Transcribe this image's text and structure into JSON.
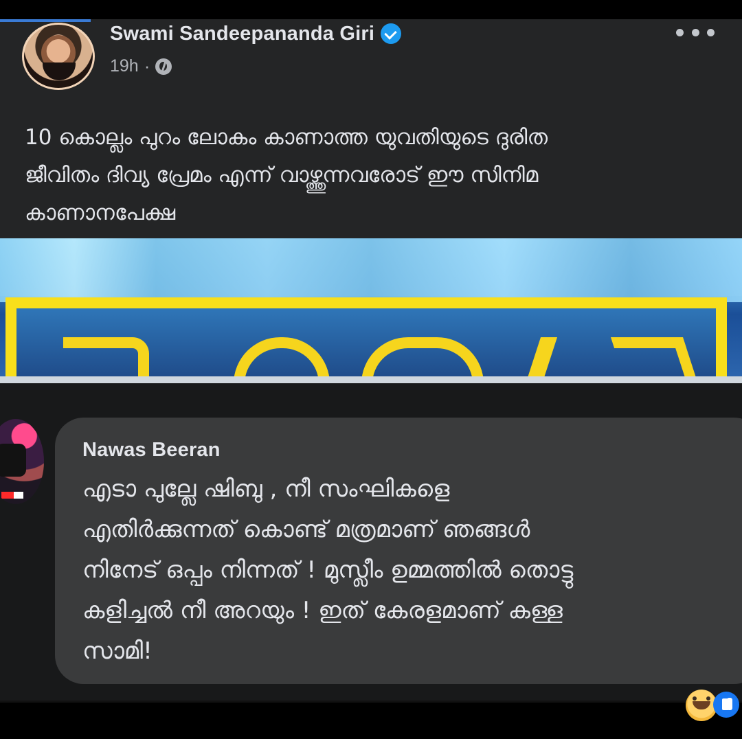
{
  "post": {
    "author": "Swami Sandeepananda Giri",
    "time": "19h",
    "dot": "·",
    "text": "10 കൊല്ലം പുറം ലോകം കാണാത്ത യുവതിയുടെ ദുരിത\nജീവിതം ദിവ്യ പ്രേമം എന്ന് വാഴ്ത്തുന്നവരോട് ഈ സിനിമ\nകാണാനപേക്ഷ"
  },
  "comment": {
    "author": "Nawas Beeran",
    "text": "എടാ പുല്ലേ  ഷിബു , നീ സംഘികളെ\nഎതിർക്കുന്നത് കൊണ്ട് മത്രമാണ് ഞങ്ങൾ\nനിനേട് ഒപ്പം നിന്നത് ! മുസ്ലീം ഉമ്മത്തിൽ തൊട്ടു\nകളിച്ചൽ നീ അറയും ! ഇത് കേരളമാണ് കള്ള\nസാമി!"
  },
  "colors": {
    "facebook_blue": "#1d9bf0",
    "card_background": "#242526",
    "comment_bubble": "#3a3b3c",
    "text_primary": "#e4e6eb",
    "text_secondary": "#b0b3b8"
  },
  "icons": {
    "verified": "verified-badge-icon",
    "globe": "globe-icon",
    "more": "more-options-icon",
    "laugh": "laugh-reaction-icon",
    "like": "like-reaction-icon"
  }
}
